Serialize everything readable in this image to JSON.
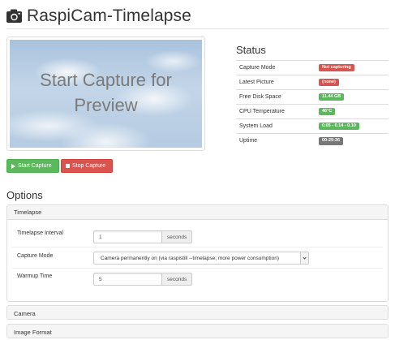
{
  "app": {
    "title": "RaspiCam-Timelapse",
    "icon": "camera-icon"
  },
  "preview": {
    "text": "Start Capture for Preview"
  },
  "status": {
    "heading": "Status",
    "rows": [
      {
        "label": "Capture Mode",
        "value": "Not capturing",
        "color": "#d9534f"
      },
      {
        "label": "Latest Picture",
        "value": "(none)",
        "color": "#d9534f"
      },
      {
        "label": "Free Disk Space",
        "value": "11.44 GB",
        "color": "#5cb85c"
      },
      {
        "label": "CPU Temperature",
        "value": "46°C",
        "color": "#5cb85c"
      },
      {
        "label": "System Load",
        "value": "0.05 - 0.14 - 0.10",
        "color": "#5cb85c"
      },
      {
        "label": "Uptime",
        "value": "00:29:36",
        "color": "#777777"
      }
    ]
  },
  "buttons": {
    "start": {
      "label": "Start Capture",
      "icon": "play-icon",
      "color": "#5cb85c"
    },
    "stop": {
      "label": "Stop Capture",
      "icon": "stop-icon",
      "color": "#d9534f"
    }
  },
  "options": {
    "heading": "Options",
    "timelapse": {
      "title": "Timelapse",
      "interval": {
        "label": "Timelapse Interval",
        "value": "1",
        "unit": "seconds"
      },
      "capture_mode": {
        "label": "Capture Mode",
        "value": "Camera permanently on (via raspistill --timelapse; more power consumption)"
      },
      "warmup": {
        "label": "Warmup Time",
        "value": "5",
        "unit": "seconds"
      }
    },
    "camera": {
      "title": "Camera"
    },
    "image_format": {
      "title": "Image Format"
    }
  }
}
